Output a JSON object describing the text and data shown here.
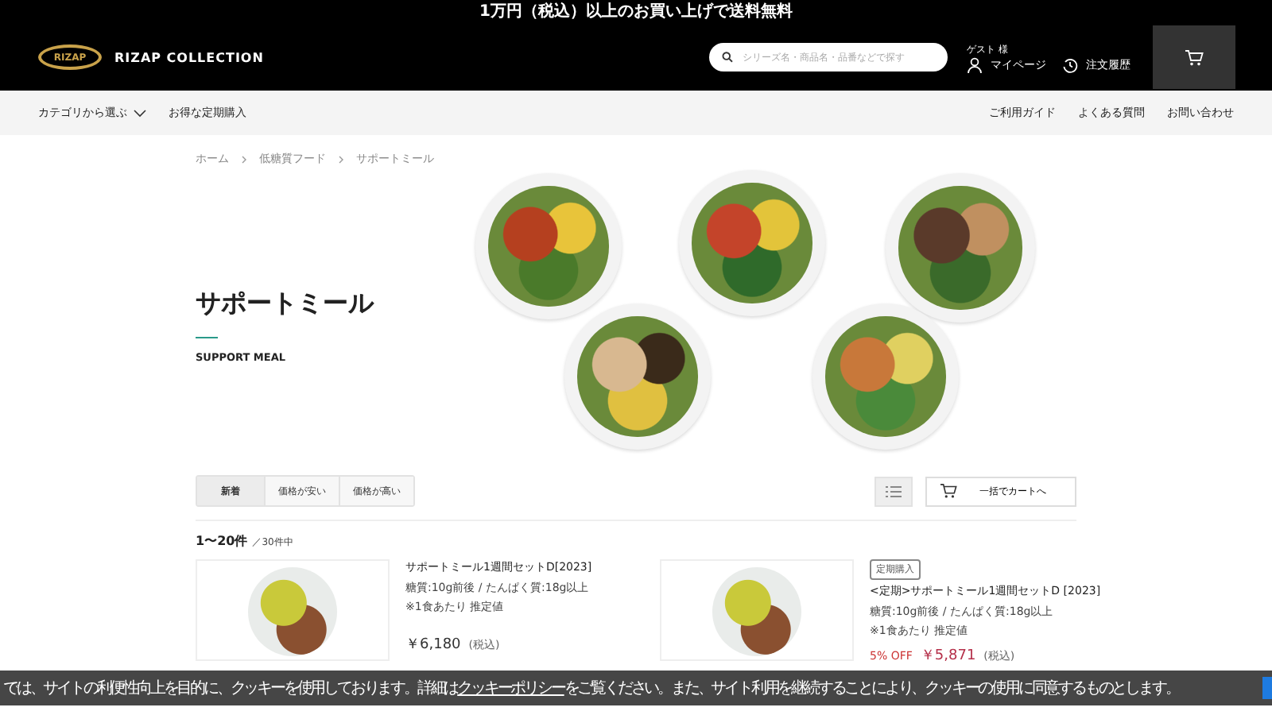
{
  "promo_bar": {
    "text": "1万円（税込）以上のお買い上げで送料無料"
  },
  "header": {
    "logo_mark": "RIZAP",
    "brand": "RIZAP COLLECTION",
    "search": {
      "placeholder": "シリーズ名・商品名・品番などで探す"
    },
    "guest": "ゲスト 様",
    "mypage": "マイページ",
    "history": "注文履歴"
  },
  "nav": {
    "left": [
      {
        "label": "カテゴリから選ぶ",
        "dropdown": true
      },
      {
        "label": "お得な定期購入",
        "dropdown": false
      }
    ],
    "right": [
      "ご利用ガイド",
      "よくある質問",
      "お問い合わせ"
    ]
  },
  "breadcrumb": [
    "ホーム",
    "低糖質フード",
    "サポートミール"
  ],
  "hero": {
    "title": "サポートミール",
    "subtitle": "SUPPORT MEAL"
  },
  "sort_tabs": [
    {
      "label": "新着",
      "selected": true
    },
    {
      "label": "価格が安い",
      "selected": false
    },
    {
      "label": "価格が高い",
      "selected": false
    }
  ],
  "bulk_cart_button": "一括でカートへ",
  "count": {
    "range": "1〜20件",
    "total": "／30件中"
  },
  "products": [
    {
      "title": "サポートミール1週間セットD[2023]",
      "nutrition": "糖質:10g前後 / たんぱく質:18g以上",
      "note": "※1食あたり 推定値",
      "price": "￥6,180",
      "tax": "(税込)"
    },
    {
      "badge": "定期購入",
      "title": "<定期>サポートミール1週間セットD [2023]",
      "nutrition": "糖質:10g前後 / たんぱく質:18g以上",
      "note": "※1食あたり 推定値",
      "discount": "5% OFF",
      "price": "￥5,871",
      "tax": "(税込)"
    }
  ],
  "cookie_banner": {
    "before": "では、サイトの利便性向上を目的に、クッキーを使用しております。詳細は",
    "link": "クッキーポリシー",
    "after": "をご覧ください。また、サイト利用を継続することにより、クッキーの使用に同意するものとします。"
  }
}
